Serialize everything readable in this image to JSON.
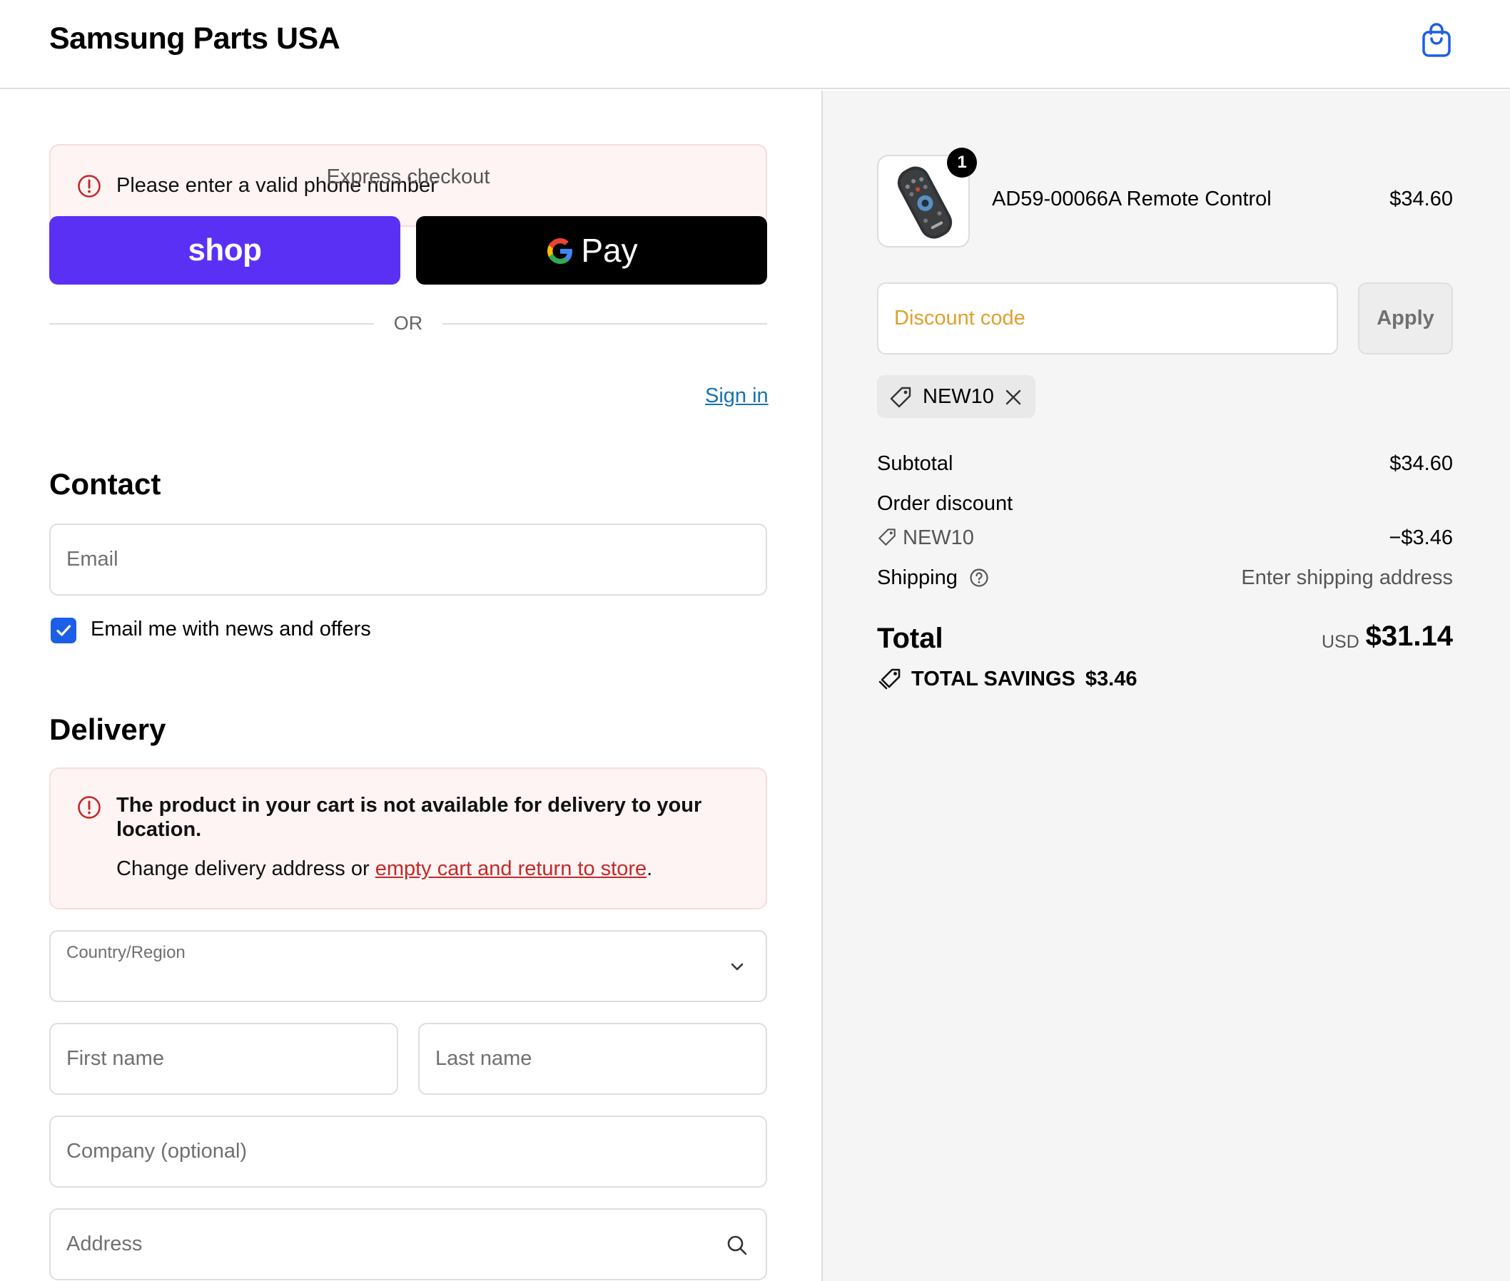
{
  "header": {
    "brand": "Samsung Parts USA",
    "cart_icon": "shopping-bag-icon"
  },
  "alerts": {
    "phone_error": "Please enter a valid phone number",
    "delivery_title": "The product in your cart is not available for delivery to your location.",
    "delivery_text_prefix": "Change delivery address or ",
    "delivery_link": "empty cart and return to store",
    "delivery_text_suffix": "."
  },
  "express": {
    "label": "Express checkout",
    "shop_label": "shop",
    "gpay_label": "Pay",
    "or_label": "OR"
  },
  "contact": {
    "heading": "Contact",
    "signin": "Sign in",
    "email_placeholder": "Email",
    "newsletter_label": "Email me with news and offers",
    "newsletter_checked": true
  },
  "delivery": {
    "heading": "Delivery",
    "country_label": "Country/Region",
    "country_value": "",
    "first_name_placeholder": "First name",
    "last_name_placeholder": "Last name",
    "company_placeholder": "Company (optional)",
    "address_placeholder": "Address"
  },
  "summary": {
    "product": {
      "name": "AD59-00066A Remote Control",
      "price": "$34.60",
      "quantity": "1"
    },
    "discount_placeholder": "Discount code",
    "apply_label": "Apply",
    "applied_code": "NEW10",
    "subtotal_label": "Subtotal",
    "subtotal_value": "$34.60",
    "order_discount_label": "Order discount",
    "discount_code": "NEW10",
    "discount_value": "−$3.46",
    "shipping_label": "Shipping",
    "shipping_value": "Enter shipping address",
    "total_label": "Total",
    "currency": "USD",
    "total_value": "$31.14",
    "savings_label": "TOTAL SAVINGS",
    "savings_value": "$3.46"
  },
  "colors": {
    "shop_purple": "#5a31f4",
    "link_blue": "#1773b0",
    "error_red": "#c62828",
    "checkbox_blue": "#1d5ee6"
  }
}
